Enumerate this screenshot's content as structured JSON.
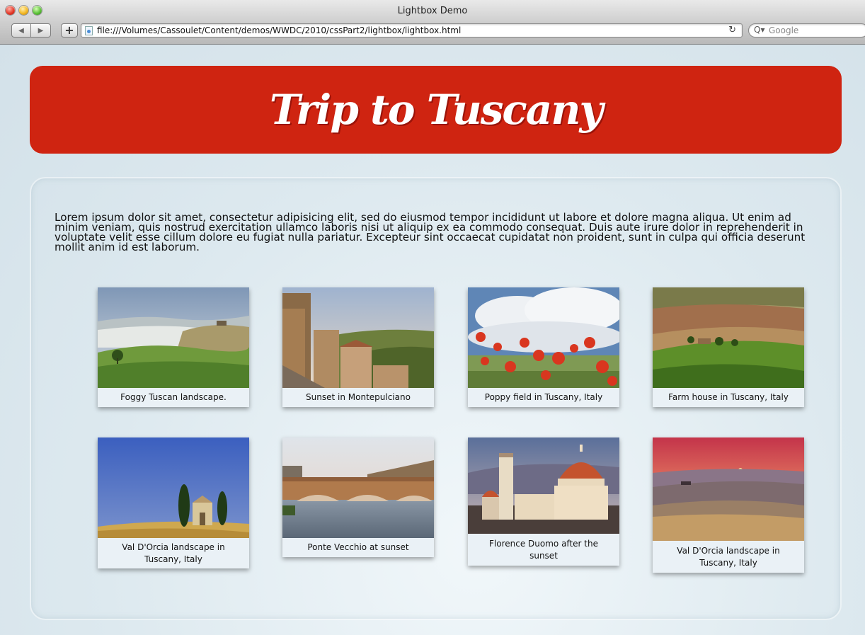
{
  "window": {
    "title": "Lightbox Demo"
  },
  "toolbar": {
    "url": "file:///Volumes/Cassoulet/Content/demos/WWDC/2010/cssPart2/lightbox/lightbox.html",
    "search_placeholder": "Google",
    "back_icon": "back-arrow-icon",
    "forward_icon": "forward-arrow-icon",
    "add_icon": "plus-icon",
    "reload_icon": "reload-icon"
  },
  "page": {
    "banner_title": "Trip to Tuscany",
    "intro": "Lorem ipsum dolor sit amet, consectetur adipisicing elit, sed do eiusmod tempor incididunt ut labore et dolore magna aliqua. Ut enim ad minim veniam, quis nostrud exercitation ullamco laboris nisi ut aliquip ex ea commodo consequat. Duis aute irure dolor in reprehenderit in voluptate velit esse cillum dolore eu fugiat nulla pariatur. Excepteur sint occaecat cupidatat non proident, sunt in culpa qui officia deserunt mollit anim id est laborum.",
    "photos": [
      {
        "caption": "Foggy Tuscan landscape."
      },
      {
        "caption": "Sunset in Montepulciano"
      },
      {
        "caption": "Poppy field in Tuscany, Italy"
      },
      {
        "caption": "Farm house in Tuscany, Italy"
      },
      {
        "caption": "Val D'Orcia landscape in Tuscany, Italy"
      },
      {
        "caption": "Ponte Vecchio at sunset"
      },
      {
        "caption": "Florence Duomo after the sunset"
      },
      {
        "caption": "Val D'Orcia landscape in Tuscany, Italy"
      }
    ]
  },
  "colors": {
    "banner": "#cf2411",
    "background": "#dbe7ee"
  }
}
